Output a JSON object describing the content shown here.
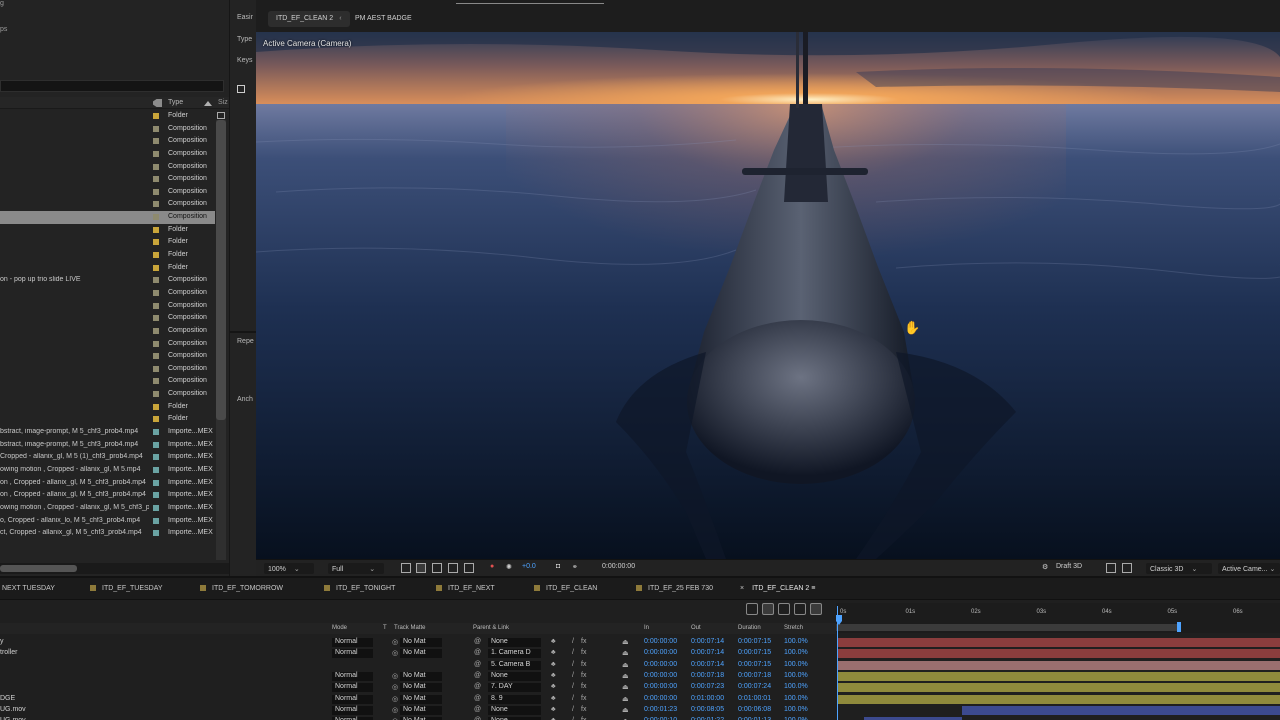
{
  "project_panel": {
    "header": {
      "type_label": "Type",
      "size_label": "Siz"
    },
    "top_fragments": [
      "g",
      "ps"
    ],
    "items": [
      {
        "name": "",
        "type": "Folder",
        "label_color": "#c9a53a",
        "selected": false
      },
      {
        "name": "",
        "type": "Composition",
        "label_color": "#8e8a6e",
        "selected": false
      },
      {
        "name": "",
        "type": "Composition",
        "label_color": "#8e8a6e",
        "selected": false
      },
      {
        "name": "",
        "type": "Composition",
        "label_color": "#8e8a6e",
        "selected": false
      },
      {
        "name": "",
        "type": "Composition",
        "label_color": "#8e8a6e",
        "selected": false
      },
      {
        "name": "",
        "type": "Composition",
        "label_color": "#8e8a6e",
        "selected": false
      },
      {
        "name": "",
        "type": "Composition",
        "label_color": "#8e8a6e",
        "selected": false
      },
      {
        "name": "",
        "type": "Composition",
        "label_color": "#8e8a6e",
        "selected": false
      },
      {
        "name": "",
        "type": "Composition",
        "label_color": "#8e8a6e",
        "selected": true
      },
      {
        "name": "",
        "type": "Folder",
        "label_color": "#c9a53a",
        "selected": false
      },
      {
        "name": "",
        "type": "Folder",
        "label_color": "#c9a53a",
        "selected": false
      },
      {
        "name": "",
        "type": "Folder",
        "label_color": "#c9a53a",
        "selected": false
      },
      {
        "name": "",
        "type": "Folder",
        "label_color": "#c9a53a",
        "selected": false
      },
      {
        "name": "on - pop up trio slide LIVE",
        "type": "Composition",
        "label_color": "#8e8a6e",
        "selected": false
      },
      {
        "name": "",
        "type": "Composition",
        "label_color": "#8e8a6e",
        "selected": false
      },
      {
        "name": "",
        "type": "Composition",
        "label_color": "#8e8a6e",
        "selected": false
      },
      {
        "name": "",
        "type": "Composition",
        "label_color": "#8e8a6e",
        "selected": false
      },
      {
        "name": "",
        "type": "Composition",
        "label_color": "#8e8a6e",
        "selected": false
      },
      {
        "name": "",
        "type": "Composition",
        "label_color": "#8e8a6e",
        "selected": false
      },
      {
        "name": "",
        "type": "Composition",
        "label_color": "#8e8a6e",
        "selected": false
      },
      {
        "name": "",
        "type": "Composition",
        "label_color": "#8e8a6e",
        "selected": false
      },
      {
        "name": "",
        "type": "Composition",
        "label_color": "#8e8a6e",
        "selected": false
      },
      {
        "name": "",
        "type": "Composition",
        "label_color": "#8e8a6e",
        "selected": false
      },
      {
        "name": "",
        "type": "Folder",
        "label_color": "#c9a53a",
        "selected": false
      },
      {
        "name": "",
        "type": "Folder",
        "label_color": "#c9a53a",
        "selected": false
      },
      {
        "name": "bstract, image-prompt, M 5_chf3_prob4.mp4",
        "type": "Importe...MEX",
        "label_color": "#6aa3a3",
        "selected": false
      },
      {
        "name": "bstract, image-prompt, M 5_chf3_prob4.mp4",
        "type": "Importe...MEX",
        "label_color": "#6aa3a3",
        "selected": false
      },
      {
        "name": "Cropped - allanix_gl, M 5 (1)_chf3_prob4.mp4",
        "type": "Importe...MEX",
        "label_color": "#6aa3a3",
        "selected": false
      },
      {
        "name": "owing motion , Cropped - allanix_gl, M 5.mp4",
        "type": "Importe...MEX",
        "label_color": "#6aa3a3",
        "selected": false
      },
      {
        "name": "on , Cropped - allanix_gl, M 5_chf3_prob4.mp4",
        "type": "Importe...MEX",
        "label_color": "#6aa3a3",
        "selected": false
      },
      {
        "name": "on , Cropped - allanix_gl, M 5_chf3_prob4.mp4",
        "type": "Importe...MEX",
        "label_color": "#6aa3a3",
        "selected": false
      },
      {
        "name": "owing motion , Cropped - allanix_gl, M 5_chf3_prob4.mp4",
        "type": "Importe...MEX",
        "label_color": "#6aa3a3",
        "selected": false
      },
      {
        "name": "o, Cropped - allanix_lo, M 5_chf3_prob4.mp4",
        "type": "Importe...MEX",
        "label_color": "#6aa3a3",
        "selected": false
      },
      {
        "name": "ct, Cropped - allanix_gl, M 5_chf3_prob4.mp4",
        "type": "Importe...MEX",
        "label_color": "#6aa3a3",
        "selected": false
      }
    ]
  },
  "effect_controls": {
    "labels": [
      "Easir",
      "Type",
      "Keys",
      "Repe",
      "Anch"
    ]
  },
  "viewer": {
    "tabs": [
      {
        "label": "ITD_EF_CLEAN 2",
        "active": true
      },
      {
        "label": "PM AEST BADGE",
        "active": false
      }
    ],
    "lock_glyph": "‹",
    "camera_label": "Active Camera (Camera)",
    "bottom_bar": {
      "zoom": "100%",
      "resolution": "Full",
      "exposure": "+0.0",
      "timecode": "0:00:00:00",
      "draft3d": "Draft 3D",
      "renderer": "Classic 3D",
      "view": "Active Came..."
    }
  },
  "timeline": {
    "tabs": [
      {
        "label": "NEXT TUESDAY",
        "color": ""
      },
      {
        "label": "ITD_EF_TUESDAY",
        "color": "#8e7a3a"
      },
      {
        "label": "ITD_EF_TOMORROW",
        "color": "#8e7a3a"
      },
      {
        "label": "ITD_EF_TONIGHT",
        "color": "#8e7a3a"
      },
      {
        "label": "ITD_EF_NEXT",
        "color": "#8e7a3a"
      },
      {
        "label": "ITD_EF_CLEAN",
        "color": "#8e7a3a"
      },
      {
        "label": "ITD_EF_25 FEB 730",
        "color": "#8e7a3a"
      },
      {
        "label": "ITD_EF_CLEAN 2",
        "color": "",
        "active": true
      }
    ],
    "close_glyph": "×",
    "menu_glyph": "≡",
    "columns": {
      "mode": "Mode",
      "t": "T",
      "track_matte": "Track Matte",
      "parent": "Parent & Link",
      "in": "In",
      "out": "Out",
      "duration": "Duration",
      "stretch": "Stretch"
    },
    "ruler_ticks": [
      "0s",
      "01s",
      "02s",
      "03s",
      "04s",
      "05s",
      "06s"
    ],
    "layers": [
      {
        "name": "y",
        "mode": "Normal",
        "matte": "No Mat",
        "parent": "None",
        "in": "0:00:00:00",
        "out": "0:00:07:14",
        "duration": "0:00:07:15",
        "stretch": "100.0%",
        "bar_color": "#8a3d3d",
        "bar_start": 0,
        "bar_end": 7.6
      },
      {
        "name": "troller",
        "mode": "Normal",
        "matte": "No Mat",
        "parent": "1. Camera D",
        "in": "0:00:00:00",
        "out": "0:00:07:14",
        "duration": "0:00:07:15",
        "stretch": "100.0%",
        "bar_color": "#8a3d3d",
        "bar_start": 0,
        "bar_end": 7.6
      },
      {
        "name": "",
        "mode": "",
        "matte": "",
        "parent": "5. Camera B",
        "in": "0:00:00:00",
        "out": "0:00:07:14",
        "duration": "0:00:07:15",
        "stretch": "100.0%",
        "bar_color": "#9a6f6f",
        "bar_start": 0,
        "bar_end": 7.6
      },
      {
        "name": "",
        "mode": "Normal",
        "matte": "No Mat",
        "parent": "None",
        "in": "0:00:00:00",
        "out": "0:00:07:18",
        "duration": "0:00:07:18",
        "stretch": "100.0%",
        "bar_color": "#8f8a3c",
        "bar_start": 0,
        "bar_end": 7.7
      },
      {
        "name": "",
        "mode": "Normal",
        "matte": "No Mat",
        "parent": "7. DAY",
        "in": "0:00:00:00",
        "out": "0:00:07:23",
        "duration": "0:00:07:24",
        "stretch": "100.0%",
        "bar_color": "#8f8a3c",
        "bar_start": 0,
        "bar_end": 7.9
      },
      {
        "name": "DGE",
        "mode": "Normal",
        "matte": "No Mat",
        "parent": "8. 9",
        "in": "0:00:00:00",
        "out": "0:01:00:00",
        "duration": "0:01:00:01",
        "stretch": "100.0%",
        "bar_color": "#8f8a3c",
        "bar_start": 0,
        "bar_end": 60
      },
      {
        "name": "UG.mov",
        "mode": "Normal",
        "matte": "No Mat",
        "parent": "None",
        "in": "0:00:01:23",
        "out": "0:00:08:05",
        "duration": "0:00:06:08",
        "stretch": "100.0%",
        "bar_color": "#3c4a8f",
        "bar_start": 1.9,
        "bar_end": 8.2
      },
      {
        "name": "UG.mov",
        "mode": "Normal",
        "matte": "No Mat",
        "parent": "None",
        "in": "0:00:00:10",
        "out": "0:00:01:22",
        "duration": "0:00:01:13",
        "stretch": "100.0%",
        "bar_color": "#3c4a8f",
        "bar_start": 0.4,
        "bar_end": 1.9
      }
    ],
    "work_area_end_seconds": 5.25
  }
}
